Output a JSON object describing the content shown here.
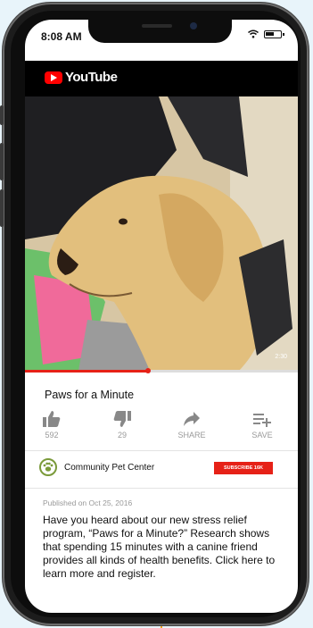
{
  "status": {
    "time": "8:08 AM"
  },
  "app": {
    "brand": "YouTube"
  },
  "video": {
    "duration": "2:30",
    "progress": 0.45
  },
  "title": "Paws for a Minute",
  "actions": {
    "like": {
      "label": "592",
      "icon": "thumbs-up-icon"
    },
    "dislike": {
      "label": "29",
      "icon": "thumbs-down-icon"
    },
    "share": {
      "label": "SHARE",
      "icon": "share-icon"
    },
    "save": {
      "label": "SAVE",
      "icon": "playlist-add-icon"
    }
  },
  "channel": {
    "name": "Community Pet Center",
    "subscribe": "SUBSCRIBE 16K"
  },
  "published": "Published on Oct 25, 2016",
  "description": "Have you heard about our new stress relief program, “Paws for a Minute?” Research shows that spending 15 minutes with a canine friend provides all kinds of health benefits. Click here to learn more and register.",
  "colors": {
    "accent": "#e62117",
    "channel_ring": "#7a9a3a",
    "background": "#e8f4fa"
  }
}
